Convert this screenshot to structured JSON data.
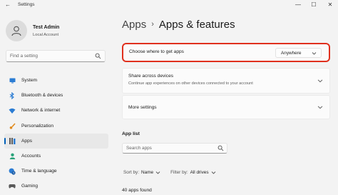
{
  "window": {
    "title": "Settings",
    "minimize_glyph": "—",
    "maximize_glyph": "☐",
    "close_glyph": "✕",
    "back_glyph": "←"
  },
  "profile": {
    "name": "Test Admin",
    "account": "Local Account"
  },
  "sidebar": {
    "search_placeholder": "Find a setting",
    "active_index": 5,
    "items": [
      {
        "label": "System",
        "icon": "monitor-icon"
      },
      {
        "label": "Bluetooth & devices",
        "icon": "bluetooth-icon"
      },
      {
        "label": "Network & internet",
        "icon": "wifi-icon"
      },
      {
        "label": "Personalization",
        "icon": "brush-icon"
      },
      {
        "label": "Apps",
        "icon": "apps-icon"
      },
      {
        "label": "Accounts",
        "icon": "person-icon"
      },
      {
        "label": "Time & language",
        "icon": "globe-clock-icon"
      },
      {
        "label": "Gaming",
        "icon": "gamepad-icon"
      }
    ]
  },
  "breadcrumb": {
    "parent": "Apps",
    "separator": "›",
    "current": "Apps & features"
  },
  "cards": {
    "where": {
      "label": "Choose where to get apps",
      "value": "Anywhere",
      "highlight_color": "#e0301e"
    },
    "share": {
      "label": "Share across devices",
      "description": "Continue app experiences on other devices connected to your account"
    },
    "more": {
      "label": "More settings"
    }
  },
  "app_list": {
    "heading": "App list",
    "search_placeholder": "Search apps",
    "sort_label": "Sort by:",
    "sort_value": "Name",
    "filter_label": "Filter by:",
    "filter_value": "All drives",
    "count_text": "40 apps found"
  },
  "colors": {
    "accent": "#005fb8",
    "background": "#f3f3f3",
    "card": "#fbfbfb"
  }
}
